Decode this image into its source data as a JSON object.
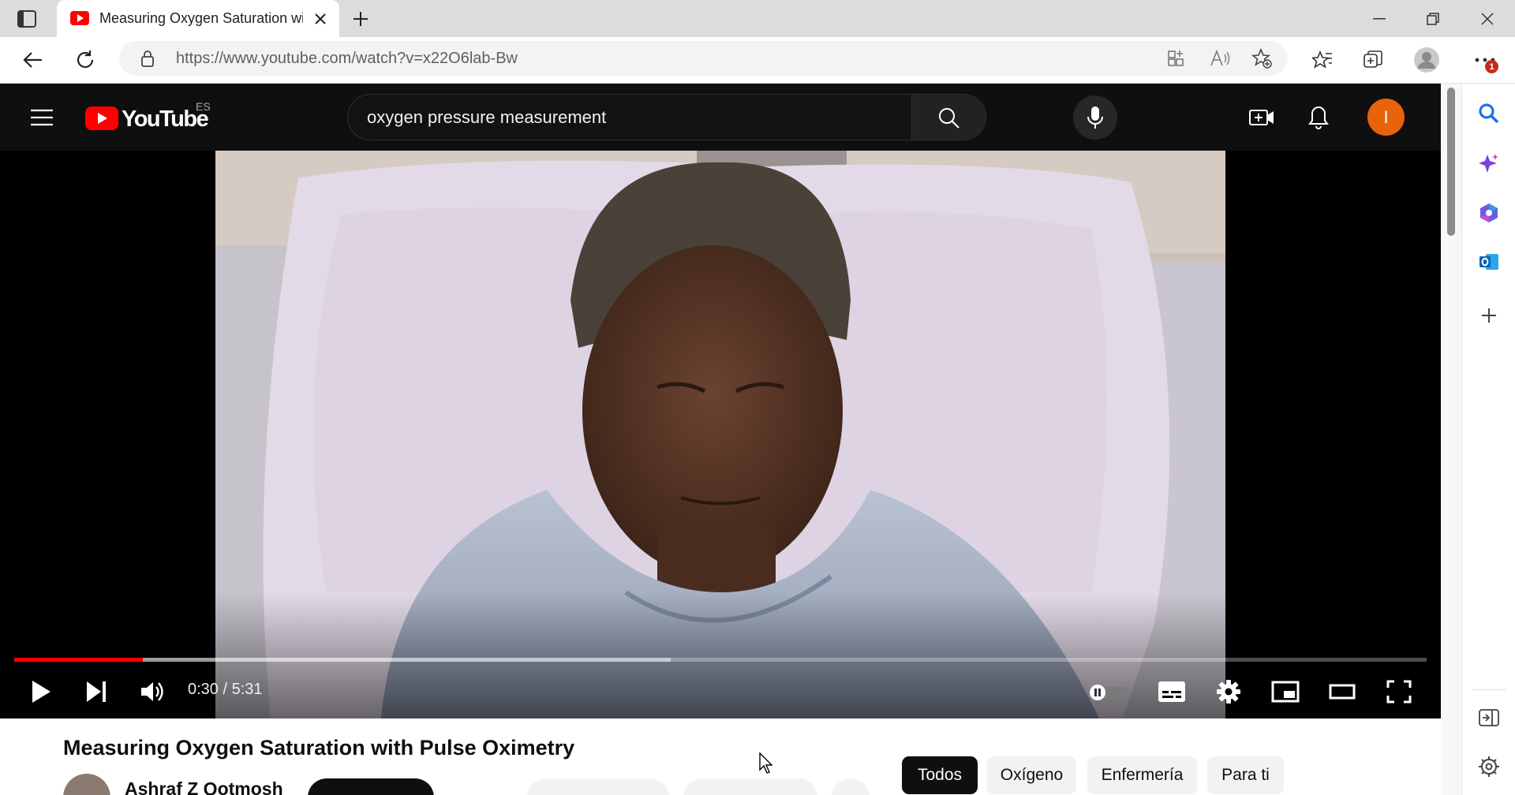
{
  "browser": {
    "tab_title": "Measuring Oxygen Saturation wi",
    "url": "https://www.youtube.com/watch?v=x22O6lab-Bw",
    "notification_count": "1"
  },
  "youtube": {
    "logo_text": "YouTube",
    "region": "ES",
    "search_value": "oxygen pressure measurement",
    "avatar_letter": "I"
  },
  "player": {
    "time": "0:30 / 5:31",
    "progress_fraction": 0.091,
    "buffer_fraction": 0.465
  },
  "video": {
    "title": "Measuring Oxygen Saturation with Pulse Oximetry",
    "channel": "Ashraf Z Qotmosh"
  },
  "chips": [
    "Todos",
    "Oxígeno",
    "Enfermería",
    "Para ti"
  ],
  "colors": {
    "youtube_red": "#ff0000",
    "avatar": "#e8630a",
    "header_bg": "#0f0f0f"
  }
}
